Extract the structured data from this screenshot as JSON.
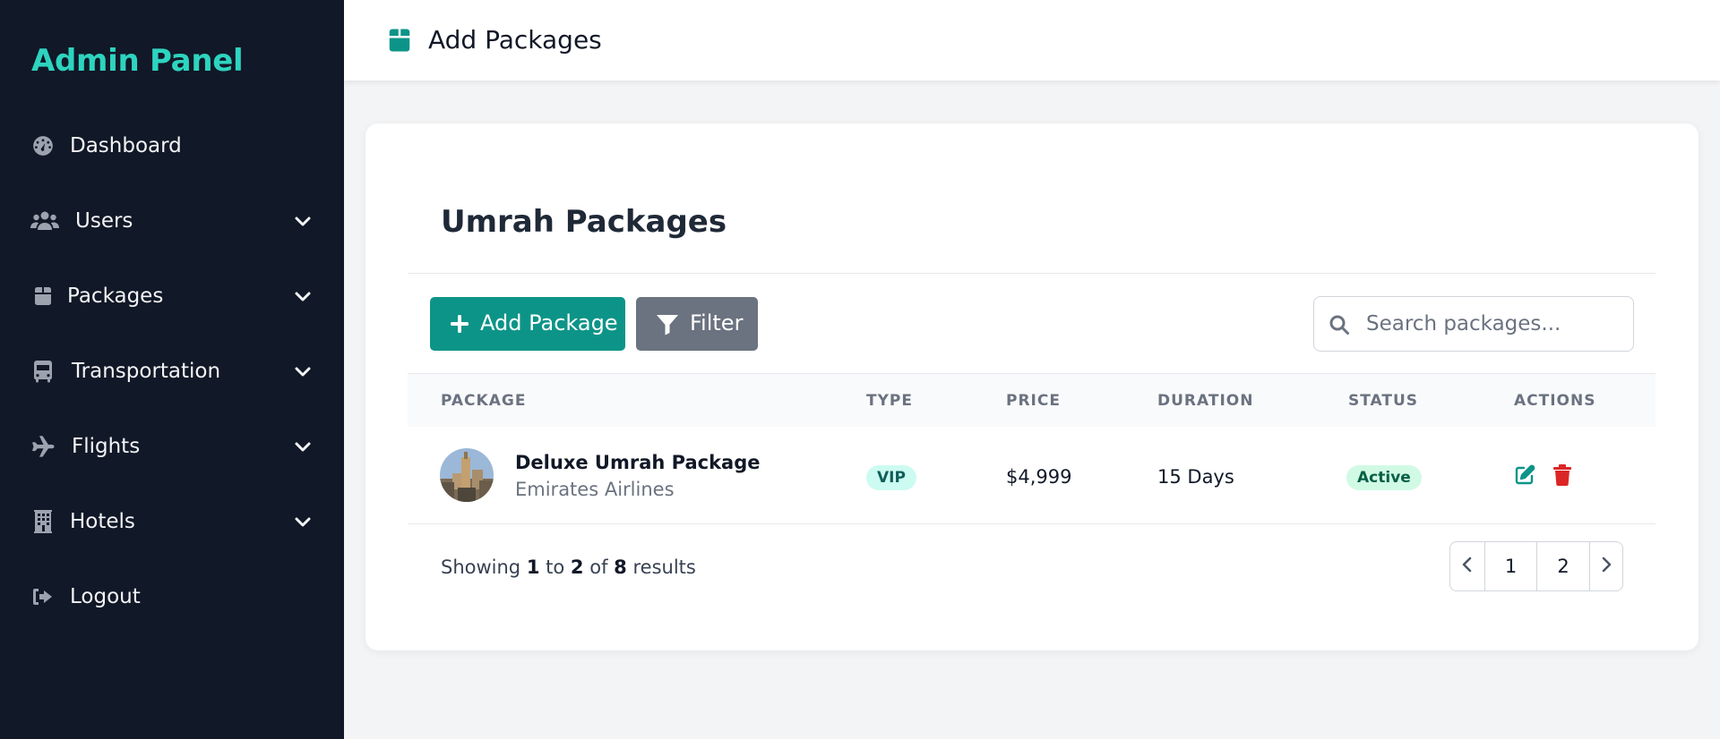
{
  "sidebar": {
    "brand": "Admin Panel",
    "items": [
      {
        "label": "Dashboard",
        "icon": "gauge-icon"
      },
      {
        "label": "Users",
        "icon": "users-icon",
        "has_submenu": true
      },
      {
        "label": "Packages",
        "icon": "box-icon",
        "has_submenu": true
      },
      {
        "label": "Transportation",
        "icon": "bus-icon",
        "has_submenu": true
      },
      {
        "label": "Flights",
        "icon": "plane-icon",
        "has_submenu": true
      },
      {
        "label": "Hotels",
        "icon": "building-icon",
        "has_submenu": true
      },
      {
        "label": "Logout",
        "icon": "logout-icon"
      }
    ]
  },
  "header": {
    "title": "Add Packages",
    "icon": "box-icon"
  },
  "main": {
    "title": "Umrah Packages",
    "add_button": "Add Package",
    "filter_button": "Filter",
    "search": {
      "placeholder": "Search packages...",
      "value": ""
    },
    "table": {
      "columns": [
        "PACKAGE",
        "TYPE",
        "PRICE",
        "DURATION",
        "STATUS",
        "ACTIONS"
      ],
      "rows": [
        {
          "name": "Deluxe Umrah Package",
          "airline": "Emirates Airlines",
          "type": "VIP",
          "price": "$4,999",
          "duration": "15 Days",
          "status": "Active"
        }
      ]
    },
    "pagination": {
      "prefix": "Showing",
      "from": "1",
      "to_word": "to",
      "to": "2",
      "of_word": "of",
      "total": "8",
      "suffix": "results",
      "pages": [
        "1",
        "2"
      ]
    }
  },
  "colors": {
    "sidebar_bg": "#111827",
    "brand": "#2dd4bf",
    "accent": "#0d9488",
    "filter": "#6b7280",
    "delete": "#dc2626",
    "active_badge_bg": "#d1fae5",
    "vip_badge_bg": "#ccfbf1"
  }
}
